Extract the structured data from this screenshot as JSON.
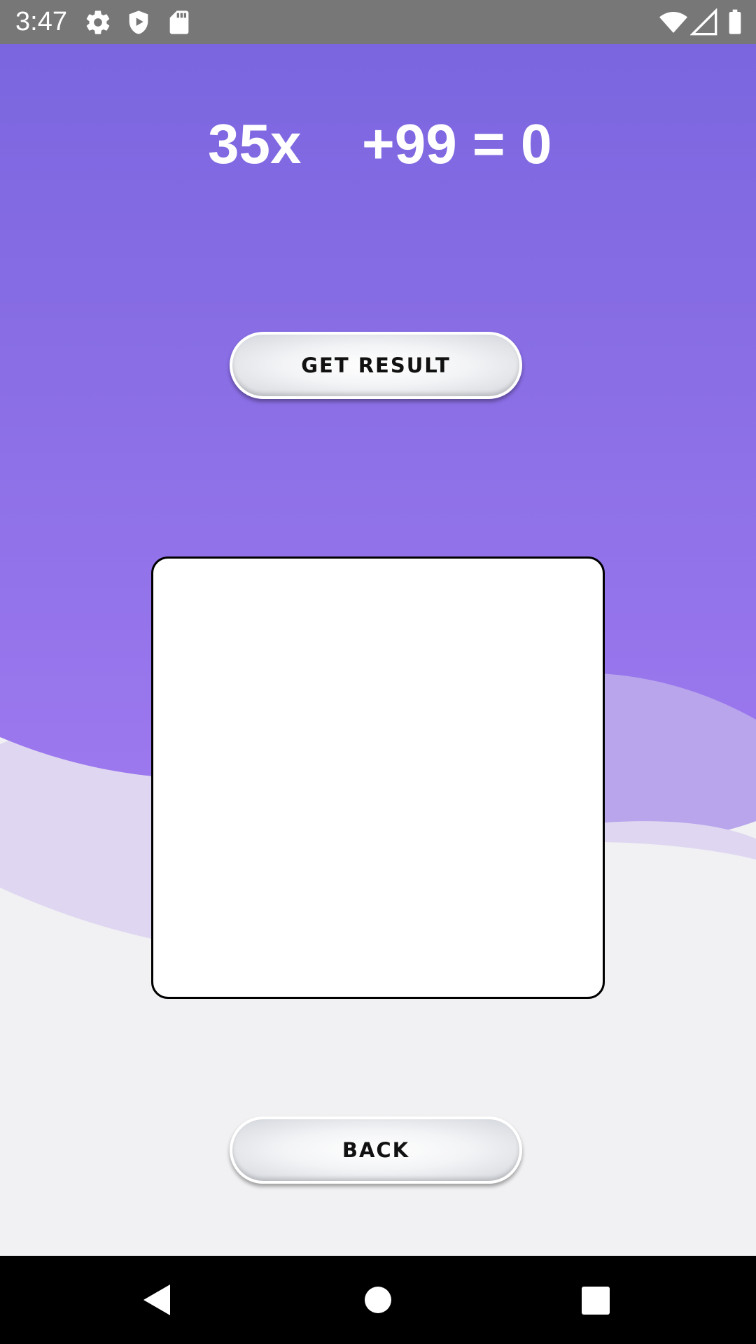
{
  "status_bar": {
    "time": "3:47",
    "icons_left": [
      "gear-icon",
      "shield-icon",
      "sd-card-icon"
    ],
    "icons_right": [
      "wifi-icon",
      "signal-icon",
      "battery-icon"
    ]
  },
  "equation": {
    "left": "35x",
    "right": "+99 = 0"
  },
  "buttons": {
    "get_result": "GET RESULT",
    "back": "BACK"
  },
  "result": {
    "text": ""
  },
  "nav_bar": {
    "icons": [
      "back-triangle-icon",
      "home-circle-icon",
      "recents-square-icon"
    ]
  },
  "colors": {
    "purple_top": "#7b66df",
    "purple_mid": "#9574ea",
    "light_wave": "#b9a5ec",
    "pale_wave": "#dfd7f1",
    "background": "#f1f1f3"
  }
}
